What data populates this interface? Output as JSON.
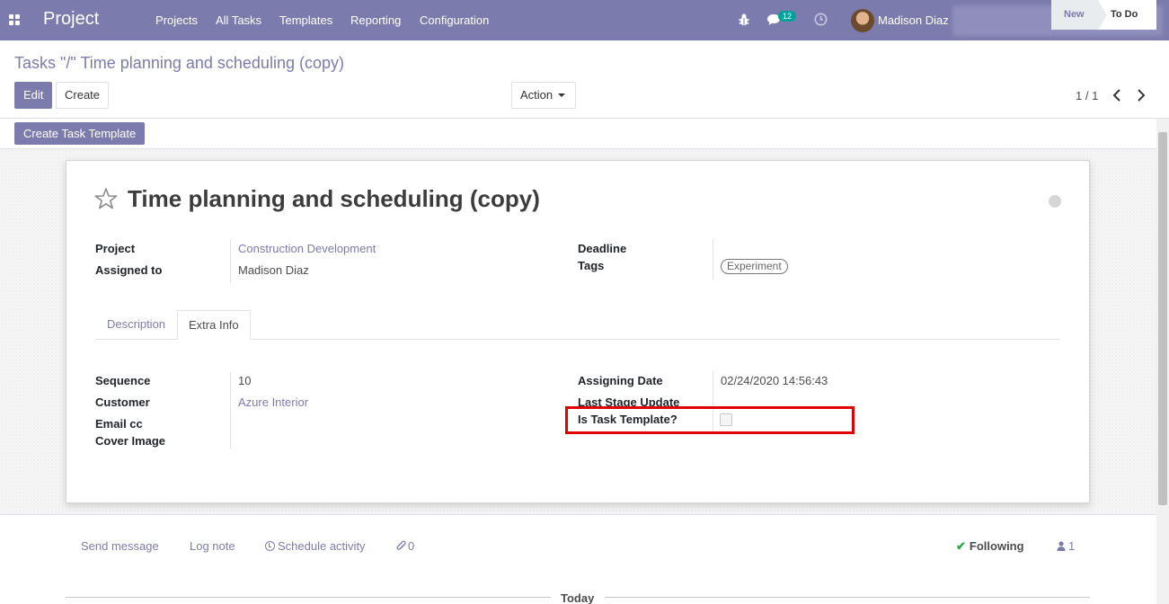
{
  "navbar": {
    "app_name": "Project",
    "menu": [
      "Projects",
      "All Tasks",
      "Templates",
      "Reporting",
      "Configuration"
    ],
    "messages_count": "12",
    "user_name": "Madison Diaz",
    "icons": [
      "apps-icon",
      "bug-icon",
      "chat-icon",
      "clock-icon"
    ]
  },
  "breadcrumb": "Tasks \"/\" Time planning and scheduling (copy)",
  "buttons": {
    "edit": "Edit",
    "create": "Create",
    "action": "Action",
    "create_template": "Create Task Template"
  },
  "pager": {
    "value": "1 / 1"
  },
  "stages": {
    "new": "New",
    "todo": "To Do"
  },
  "task": {
    "title": "Time planning and scheduling (copy)",
    "fields_left": {
      "project_label": "Project",
      "project_value": "Construction Development",
      "assigned_label": "Assigned to",
      "assigned_value": "Madison Diaz"
    },
    "fields_right": {
      "deadline_label": "Deadline",
      "tags_label": "Tags",
      "tag_value": "Experiment"
    }
  },
  "tabs": {
    "description": "Description",
    "extra_info": "Extra Info"
  },
  "extra_info": {
    "sequence_label": "Sequence",
    "sequence_value": "10",
    "customer_label": "Customer",
    "customer_value": "Azure Interior",
    "email_cc_label": "Email cc",
    "cover_image_label": "Cover Image",
    "assigning_date_label": "Assigning Date",
    "assigning_date_value": "02/24/2020 14:56:43",
    "last_stage_update_label": "Last Stage Update",
    "is_task_template_label": "Is Task Template?",
    "is_task_template_value": false
  },
  "chatter": {
    "send_message": "Send message",
    "log_note": "Log note",
    "schedule_activity": "Schedule activity",
    "attachments_count": "0",
    "following": "Following",
    "followers_count": "1",
    "today": "Today"
  },
  "colors": {
    "brand": "#7c7bad",
    "highlight": "#e00000",
    "following_check": "#28a745"
  }
}
